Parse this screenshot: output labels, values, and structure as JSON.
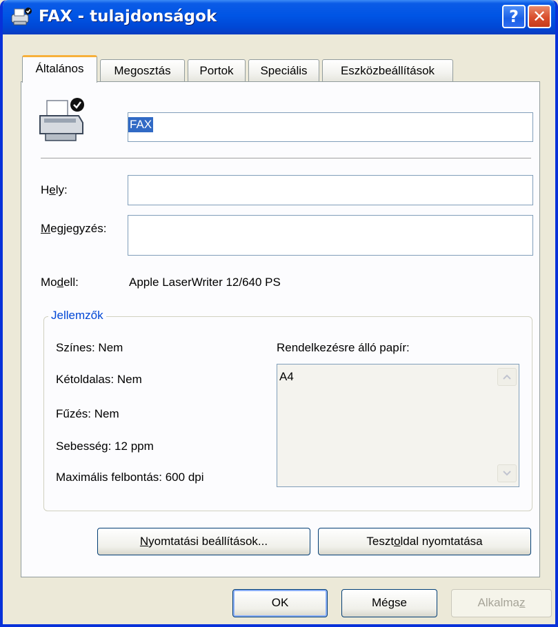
{
  "window": {
    "title": "FAX - tulajdonságok",
    "help_button": "?",
    "close_button": "✕",
    "title_icon": "printer-fax-icon",
    "colors": {
      "titlebar": "#0055e5",
      "tab_highlight": "#f7b03a",
      "group_legend": "#0046d5",
      "selection": "#316ac5"
    }
  },
  "tabs": [
    {
      "label": "Általános",
      "active": true
    },
    {
      "label": "Megosztás",
      "active": false
    },
    {
      "label": "Portok",
      "active": false
    },
    {
      "label": "Speciális",
      "active": false
    },
    {
      "label": "Eszközbeállítások",
      "active": false
    }
  ],
  "general": {
    "printer_icon": "printer-default-icon",
    "printer_name": "FAX",
    "location": {
      "label_pre": "H",
      "label_u": "e",
      "label_post": "ly:",
      "value": ""
    },
    "comment": {
      "label_pre": "",
      "label_u": "M",
      "label_post": "egjegyzés:",
      "value": ""
    },
    "model": {
      "label_pre": "Mo",
      "label_u": "d",
      "label_post": "ell:",
      "value": "Apple LaserWriter 12/640 PS"
    }
  },
  "features": {
    "legend": "Jellemzők",
    "color": "Színes: Nem",
    "duplex": "Kétoldalas: Nem",
    "staple": "Fűzés: Nem",
    "speed": "Sebesség: 12 ppm",
    "max_resolution": "Maximális felbontás: 600 dpi",
    "paper_label": "Rendelkezésre álló papír:",
    "papers": [
      "A4"
    ]
  },
  "buttons": {
    "print_prefs": {
      "pre": "",
      "u": "N",
      "post": "yomtatási beállítások..."
    },
    "test_page": {
      "pre": "Teszt",
      "u": "o",
      "post": "ldal nyomtatása"
    },
    "ok": "OK",
    "cancel": "Mégse",
    "apply": {
      "pre": "Alkalma",
      "u": "z",
      "post": ""
    }
  }
}
